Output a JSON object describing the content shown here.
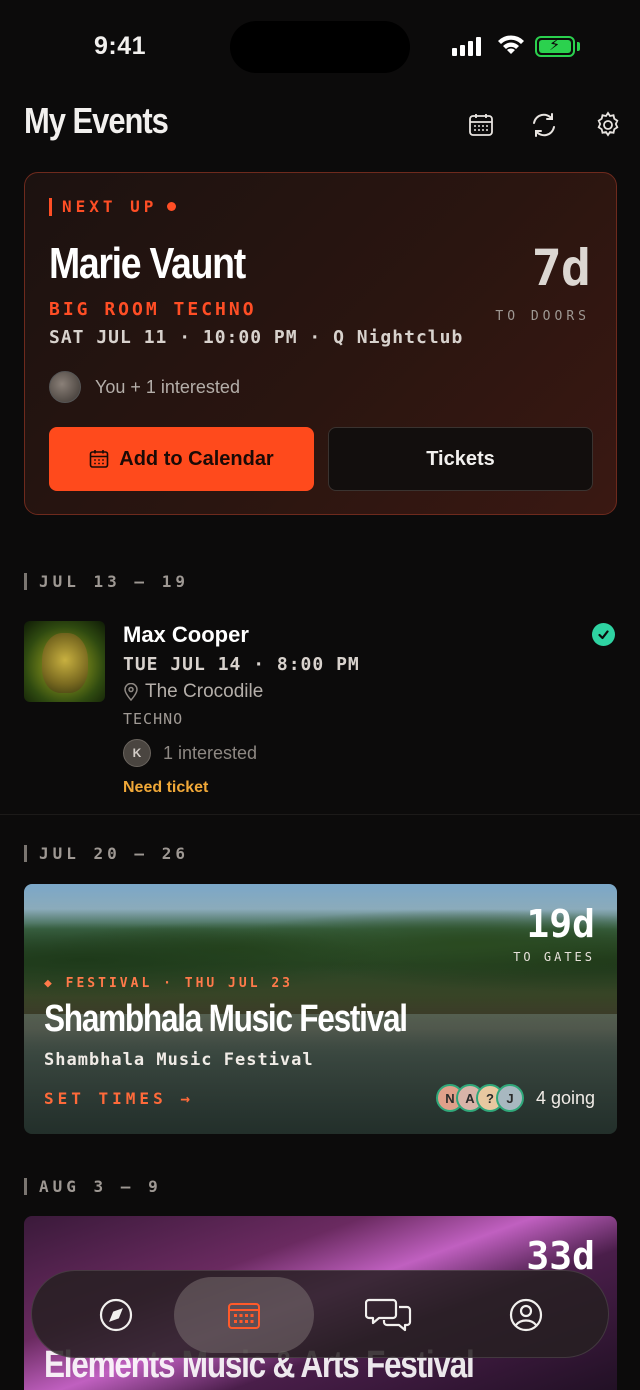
{
  "status_bar": {
    "time": "9:41"
  },
  "header": {
    "title": "My Events"
  },
  "next_up": {
    "label": "NEXT UP",
    "artist": "Marie Vaunt",
    "genre": "BIG ROOM TECHNO",
    "when": "SAT JUL 11 · 10:00 PM · Q Nightclub",
    "countdown": "7d",
    "countdown_label": "TO DOORS",
    "interested": "You + 1 interested",
    "add_to_calendar": "Add to Calendar",
    "tickets": "Tickets"
  },
  "weeks": [
    {
      "label": "JUL 13 — 19"
    },
    {
      "label": "JUL 20 — 26"
    },
    {
      "label": "AUG 3 — 9"
    }
  ],
  "event": {
    "artist": "Max Cooper",
    "when": "TUE JUL 14 · 8:00 PM",
    "venue": "The Crocodile",
    "genre": "TECHNO",
    "avatar_initial": "K",
    "interested": "1 interested",
    "status": "Need ticket"
  },
  "festival": {
    "countdown": "19d",
    "countdown_label": "TO GATES",
    "tag": "◆ FESTIVAL · THU JUL 23",
    "title": "Shambhala Music Festival",
    "subtitle": "Shambhala Music Festival",
    "set_times": "SET TIMES →",
    "attendees": [
      "N",
      "A",
      "?",
      "J"
    ],
    "going": "4 going"
  },
  "festival2": {
    "countdown": "33d",
    "title": "Elements Music & Arts Festival"
  },
  "colors": {
    "accent": "#ff4a1c",
    "check": "#2fd3a2",
    "warning": "#f0a838"
  },
  "tabbar": {
    "tabs": [
      {
        "icon": "compass-icon"
      },
      {
        "icon": "calendar-icon",
        "active": true
      },
      {
        "icon": "chat-icon"
      },
      {
        "icon": "profile-icon"
      }
    ]
  }
}
